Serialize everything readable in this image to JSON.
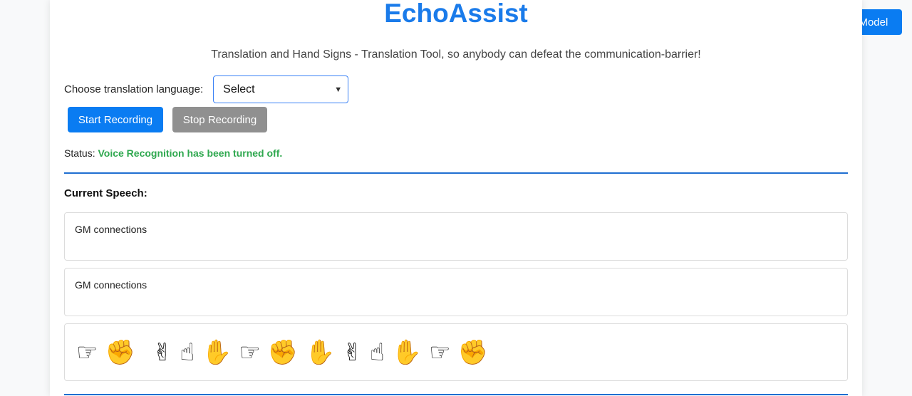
{
  "app": {
    "title": "EchoAssist",
    "subtitle": "Translation and Hand Signs - Translation Tool, so anybody can defeat the communication-barrier!",
    "train_button": "Train Model"
  },
  "language": {
    "label": "Choose translation language:",
    "selected": "Select"
  },
  "controls": {
    "start_label": "Start Recording",
    "stop_label": "Stop Recording"
  },
  "status": {
    "label": "Status:",
    "value": "Voice Recognition has been turned off."
  },
  "speech": {
    "title": "Current Speech:",
    "transcript": "GM connections",
    "translation": "GM connections",
    "signs": [
      "G",
      "M",
      " ",
      "C",
      "O",
      "N",
      "N",
      "E",
      "C",
      "T",
      "I",
      "O",
      "N",
      "S"
    ]
  },
  "colors": {
    "accent": "#0a7cf2",
    "title": "#1a7bea",
    "status_ok": "#2fa84f",
    "divider": "#1f6fd1",
    "disabled": "#909090"
  }
}
